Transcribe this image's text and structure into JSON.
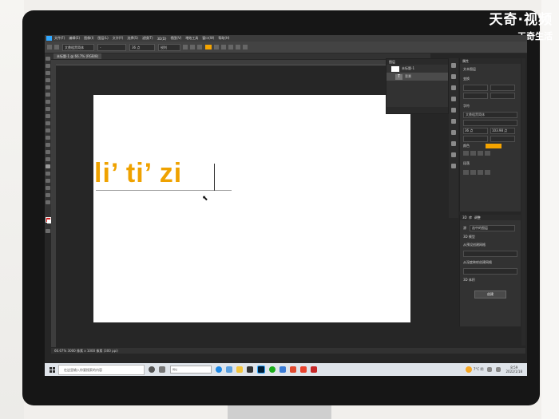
{
  "brand": {
    "line1": "天奇·视频",
    "line2": "天奇生活"
  },
  "menubar": {
    "items": [
      "文件(F)",
      "编辑(E)",
      "图像(I)",
      "图层(L)",
      "文字(Y)",
      "选择(S)",
      "滤镜(T)",
      "3D(D)",
      "视图(V)",
      "增效工具",
      "窗口(W)",
      "帮助(H)"
    ]
  },
  "options": {
    "font_family": "文鼎粗黑简体",
    "font_style": "-",
    "font_size": "36 点",
    "antialias": "锐利",
    "text_color": "#f5a400"
  },
  "document": {
    "tab_label": "未标题-1 @ 66.7% (RGB/8)"
  },
  "artwork": {
    "text": "li’ ti’ zi",
    "color": "#efa200"
  },
  "layers": {
    "title": "图层",
    "items": [
      {
        "name": "未标题-1"
      },
      {
        "name": "背景"
      }
    ]
  },
  "properties": {
    "title": "属性",
    "section_doc": "文本图层",
    "section_transform": "变换",
    "section_char": "字符",
    "font": "文鼎粗黑简体",
    "size": "36 点",
    "leading": "103.98 点",
    "color_label": "颜色",
    "section_para": "段落"
  },
  "panel3d": {
    "tab1": "3D",
    "tab2": "库",
    "tab3": "调整",
    "source_label": "源",
    "source_value": "选中的图层",
    "options": [
      "3D 模型",
      "从预设创建网格",
      "从深度映射创建网格",
      "3D 体积"
    ],
    "create_label": "创建"
  },
  "status": {
    "text": "66.67%   3000 像素 x 1000 像素 (300 ppi)"
  },
  "taskbar": {
    "search_placeholder": "在这里输入你要搜索的内容",
    "address_placeholder": "网址",
    "weather": "7°C 阴",
    "time": "8:59",
    "date": "2022/1/18"
  }
}
